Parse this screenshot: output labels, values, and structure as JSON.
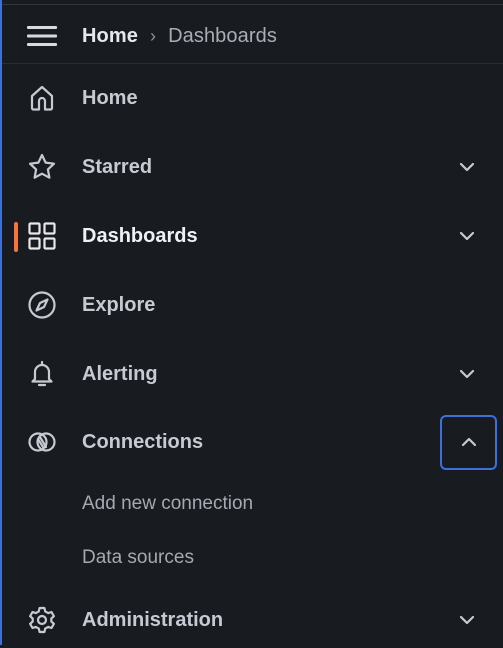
{
  "header": {
    "breadcrumb_home": "Home",
    "breadcrumb_separator": "›",
    "breadcrumb_current": "Dashboards"
  },
  "nav": {
    "items": [
      {
        "label": "Home",
        "icon": "home-icon",
        "has_chevron": false
      },
      {
        "label": "Starred",
        "icon": "star-icon",
        "has_chevron": true,
        "expanded": false
      },
      {
        "label": "Dashboards",
        "icon": "apps-grid-icon",
        "has_chevron": true,
        "expanded": false,
        "active": true
      },
      {
        "label": "Explore",
        "icon": "compass-icon",
        "has_chevron": false
      },
      {
        "label": "Alerting",
        "icon": "bell-icon",
        "has_chevron": true,
        "expanded": false
      },
      {
        "label": "Connections",
        "icon": "connections-icon",
        "has_chevron": true,
        "expanded": true
      },
      {
        "label": "Administration",
        "icon": "cog-icon",
        "has_chevron": true,
        "expanded": false
      }
    ],
    "connections_children": [
      {
        "label": "Add new connection"
      },
      {
        "label": "Data sources"
      }
    ]
  },
  "colors": {
    "background": "#181b1f",
    "active_indicator": "#f7743a",
    "focus_border": "#3d71d9",
    "text_primary": "#ccccdc",
    "text_secondary": "#a5a9b2"
  }
}
